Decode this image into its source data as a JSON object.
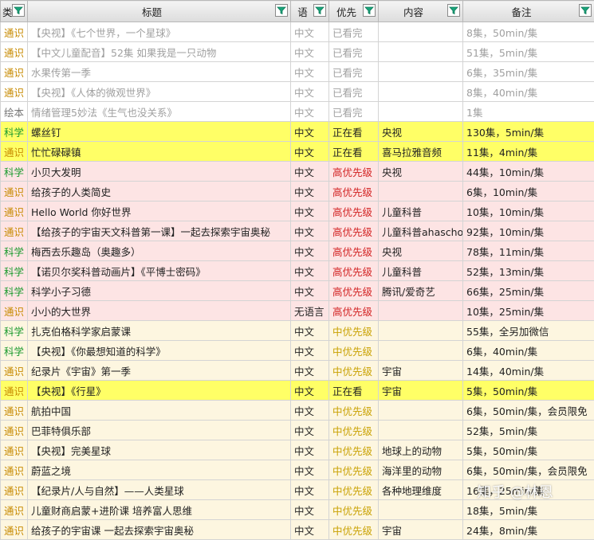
{
  "headers": [
    "类",
    "标题",
    "语",
    "优先",
    "内容",
    "备注"
  ],
  "rows": [
    {
      "cat": "通识",
      "cat_class": "cat-tongshi",
      "title": "【央视】《七个世界，一个星球》",
      "lang": "中文",
      "status": "已看完",
      "status_class": "",
      "content": "",
      "note": "8集，50min/集",
      "row_class": "done"
    },
    {
      "cat": "通识",
      "cat_class": "cat-tongshi",
      "title": "【中文儿童配音】52集 如果我是一只动物",
      "lang": "中文",
      "status": "已看完",
      "status_class": "",
      "content": "",
      "note": "51集，5min/集",
      "row_class": "done"
    },
    {
      "cat": "通识",
      "cat_class": "cat-tongshi",
      "title": "水果传第一季",
      "lang": "中文",
      "status": "已看完",
      "status_class": "",
      "content": "",
      "note": "6集，35min/集",
      "row_class": "done"
    },
    {
      "cat": "通识",
      "cat_class": "cat-tongshi",
      "title": "【央视】《人体的微观世界》",
      "lang": "中文",
      "status": "已看完",
      "status_class": "",
      "content": "",
      "note": "8集，40min/集",
      "row_class": "done"
    },
    {
      "cat": "绘本",
      "cat_class": "cat-huiben",
      "title": "情绪管理5妙法《生气也没关系》",
      "lang": "中文",
      "status": "已看完",
      "status_class": "",
      "content": "",
      "note": "1集",
      "row_class": "done"
    },
    {
      "cat": "科学",
      "cat_class": "cat-kexue",
      "title": "螺丝钉",
      "lang": "中文",
      "status": "正在看",
      "status_class": "st-watch",
      "content": "央视",
      "note": "130集，5min/集",
      "row_class": "watching"
    },
    {
      "cat": "通识",
      "cat_class": "cat-tongshi",
      "title": "忙忙碌碌镇",
      "lang": "中文",
      "status": "正在看",
      "status_class": "st-watch",
      "content": "喜马拉雅音频",
      "note": "11集，4min/集",
      "row_class": "watching"
    },
    {
      "cat": "科学",
      "cat_class": "cat-kexue",
      "title": "小贝大发明",
      "lang": "中文",
      "status": "高优先级",
      "status_class": "st-high",
      "content": "央视",
      "note": "44集，10min/集",
      "row_class": "high"
    },
    {
      "cat": "通识",
      "cat_class": "cat-tongshi",
      "title": "给孩子的人类简史",
      "lang": "中文",
      "status": "高优先级",
      "status_class": "st-high",
      "content": "",
      "note": "6集，10min/集",
      "row_class": "high"
    },
    {
      "cat": "通识",
      "cat_class": "cat-tongshi",
      "title": "Hello World 你好世界",
      "lang": "中文",
      "status": "高优先级",
      "status_class": "st-high",
      "content": "儿童科普",
      "note": "10集，10min/集",
      "row_class": "high"
    },
    {
      "cat": "通识",
      "cat_class": "cat-tongshi",
      "title": "【给孩子的宇宙天文科普第一课】一起去探索宇宙奥秘",
      "lang": "中文",
      "status": "高优先级",
      "status_class": "st-high",
      "content": "儿童科普ahaschool",
      "note": "92集，10min/集",
      "row_class": "high"
    },
    {
      "cat": "科学",
      "cat_class": "cat-kexue",
      "title": "梅西去乐趣岛（奥趣多）",
      "lang": "中文",
      "status": "高优先级",
      "status_class": "st-high",
      "content": "央视",
      "note": "78集，11min/集",
      "row_class": "high"
    },
    {
      "cat": "科学",
      "cat_class": "cat-kexue",
      "title": "【诺贝尔奖科普动画片】《平博士密码》",
      "lang": "中文",
      "status": "高优先级",
      "status_class": "st-high",
      "content": "儿童科普",
      "note": "52集，13min/集",
      "row_class": "high"
    },
    {
      "cat": "科学",
      "cat_class": "cat-kexue",
      "title": "科学小子习德",
      "lang": "中文",
      "status": "高优先级",
      "status_class": "st-high",
      "content": "腾讯/爱奇艺",
      "note": "66集，25min/集",
      "row_class": "high"
    },
    {
      "cat": "通识",
      "cat_class": "cat-tongshi",
      "title": "小小的大世界",
      "lang": "无语言",
      "status": "高优先级",
      "status_class": "st-high",
      "content": "",
      "note": "10集，25min/集",
      "row_class": "high"
    },
    {
      "cat": "科学",
      "cat_class": "cat-kexue",
      "title": "扎克伯格科学家启蒙课",
      "lang": "中文",
      "status": "中优先级",
      "status_class": "st-mid",
      "content": "",
      "note": "55集，全另加微信",
      "row_class": "mid"
    },
    {
      "cat": "科学",
      "cat_class": "cat-kexue",
      "title": "【央视】《你最想知道的科学》",
      "lang": "中文",
      "status": "中优先级",
      "status_class": "st-mid",
      "content": "",
      "note": "6集，40min/集",
      "row_class": "mid"
    },
    {
      "cat": "通识",
      "cat_class": "cat-tongshi",
      "title": "纪录片《宇宙》第一季",
      "lang": "中文",
      "status": "中优先级",
      "status_class": "st-mid",
      "content": "宇宙",
      "note": "14集，40min/集",
      "row_class": "mid"
    },
    {
      "cat": "通识",
      "cat_class": "cat-tongshi",
      "title": "【央视】《行星》",
      "lang": "中文",
      "status": "正在看",
      "status_class": "st-watch",
      "content": "宇宙",
      "note": "5集，50min/集",
      "row_class": "watching"
    },
    {
      "cat": "通识",
      "cat_class": "cat-tongshi",
      "title": "航拍中国",
      "lang": "中文",
      "status": "中优先级",
      "status_class": "st-mid",
      "content": "",
      "note": "6集，50min/集，会员限免",
      "row_class": "mid"
    },
    {
      "cat": "通识",
      "cat_class": "cat-tongshi",
      "title": "巴菲特俱乐部",
      "lang": "中文",
      "status": "中优先级",
      "status_class": "st-mid",
      "content": "",
      "note": "52集，5min/集",
      "row_class": "mid"
    },
    {
      "cat": "通识",
      "cat_class": "cat-tongshi",
      "title": "【央视】完美星球",
      "lang": "中文",
      "status": "中优先级",
      "status_class": "st-mid",
      "content": "地球上的动物",
      "note": "5集，50min/集",
      "row_class": "mid"
    },
    {
      "cat": "通识",
      "cat_class": "cat-tongshi",
      "title": "蔚蓝之境",
      "lang": "中文",
      "status": "中优先级",
      "status_class": "st-mid",
      "content": "海洋里的动物",
      "note": "6集，50min/集，会员限免",
      "row_class": "mid"
    },
    {
      "cat": "通识",
      "cat_class": "cat-tongshi",
      "title": "【纪录片/人与自然】——人类星球",
      "lang": "中文",
      "status": "中优先级",
      "status_class": "st-mid",
      "content": "各种地理维度",
      "note": "16集，25min/集",
      "row_class": "mid"
    },
    {
      "cat": "通识",
      "cat_class": "cat-tongshi",
      "title": "儿童财商启蒙+进阶课 培养富人思维",
      "lang": "中文",
      "status": "中优先级",
      "status_class": "st-mid",
      "content": "",
      "note": "18集，5min/集",
      "row_class": "mid"
    },
    {
      "cat": "通识",
      "cat_class": "cat-tongshi",
      "title": "给孩子的宇宙课 一起去探索宇宙奥秘",
      "lang": "中文",
      "status": "中优先级",
      "status_class": "st-mid",
      "content": "宇宙",
      "note": "24集，8min/集",
      "row_class": "mid"
    }
  ],
  "watermark": "知乎 @林恩",
  "colors": {
    "watching_bg": "#ffff66",
    "high_bg": "#fde4e4",
    "mid_bg": "#fdf6e0",
    "high_text": "#d22020",
    "mid_text": "#c9a100",
    "tongshi_text": "#c78a00",
    "kexue_text": "#1a9a2e"
  },
  "icons": {
    "filter": "filter-icon"
  }
}
